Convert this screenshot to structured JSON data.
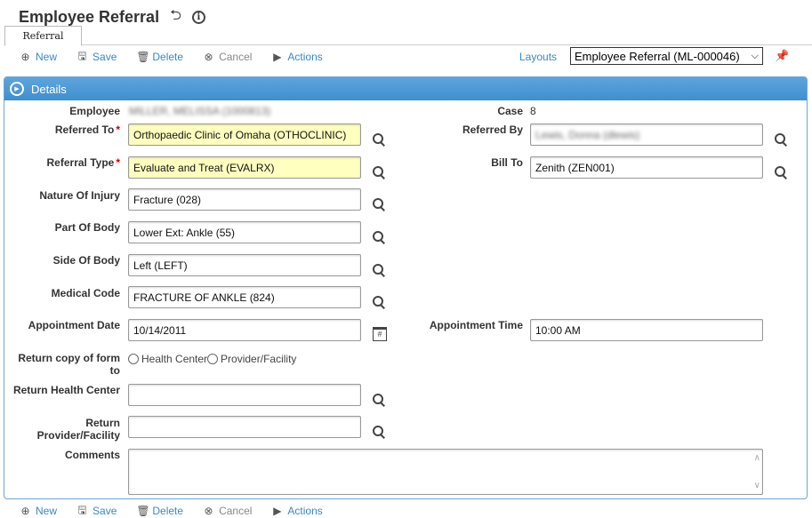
{
  "page": {
    "title": "Employee Referral"
  },
  "tabs": [
    {
      "label": "Referral"
    }
  ],
  "toolbar": {
    "new_label": "New",
    "save_label": "Save",
    "delete_label": "Delete",
    "cancel_label": "Cancel",
    "actions_label": "Actions"
  },
  "layouts": {
    "label": "Layouts",
    "selected": "Employee Referral (ML-000046)"
  },
  "details": {
    "header": "Details",
    "employee": {
      "label": "Employee",
      "value": "MILLER, MELISSA (1000813)"
    },
    "case": {
      "label": "Case",
      "value": "8"
    },
    "referred_to": {
      "label": "Referred To",
      "required": "*",
      "value": "Orthopaedic Clinic of Omaha (OTHOCLINIC)"
    },
    "referred_by": {
      "label": "Referred By",
      "value": "Lewis, Donna (dlewis)"
    },
    "referral_type": {
      "label": "Referral Type",
      "required": "*",
      "value": "Evaluate and Treat (EVALRX)"
    },
    "bill_to": {
      "label": "Bill To",
      "value": "Zenith (ZEN001)"
    },
    "nature_of_injury": {
      "label": "Nature Of Injury",
      "value": "Fracture (028)"
    },
    "part_of_body": {
      "label": "Part Of Body",
      "value": "Lower Ext: Ankle (55)"
    },
    "side_of_body": {
      "label": "Side Of Body",
      "value": "Left (LEFT)"
    },
    "medical_code": {
      "label": "Medical Code",
      "value": "FRACTURE OF ANKLE (824)"
    },
    "appointment_date": {
      "label": "Appointment Date",
      "value": "10/14/2011"
    },
    "appointment_time": {
      "label": "Appointment Time",
      "value": "10:00 AM"
    },
    "return_copy": {
      "label_line1": "Return copy of form",
      "label_line2": "to",
      "options": [
        "Health Center",
        "Provider/Facility"
      ]
    },
    "return_health_center": {
      "label": "Return Health Center",
      "value": ""
    },
    "return_provider": {
      "label_line1": "Return",
      "label_line2": "Provider/Facility",
      "value": ""
    },
    "comments": {
      "label": "Comments",
      "value": ""
    }
  },
  "colors": {
    "accent": "#3a87c7",
    "header": "#4a97d6",
    "required_bg": "#ffffc0",
    "required_star": "#cc0000"
  }
}
